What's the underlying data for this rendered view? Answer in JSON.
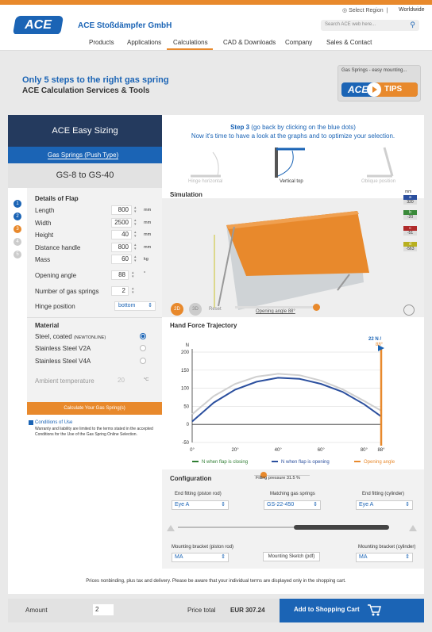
{
  "header": {
    "company": "ACE Stoßdämpfer GmbH",
    "logo_text": "ACE",
    "select_region": "Select Region",
    "separator": "|",
    "worldwide": "Worldwide",
    "search_placeholder": "Search ACE web here..."
  },
  "nav": {
    "items": [
      "Products",
      "Applications",
      "Calculations",
      "CAD & Downloads",
      "Company",
      "Sales & Contact"
    ],
    "active": "Calculations"
  },
  "hero": {
    "line1": "Only 5 steps to the right gas spring",
    "line2": "ACE Calculation Services & Tools",
    "tips_caption": "Gas Springs - easy mounting...",
    "tips_ace": "ACE",
    "tips_label": "TIPS"
  },
  "sizing": {
    "title": "ACE Easy Sizing",
    "subtitle": "Gas Springs (Push Type)",
    "range": "GS-8 to GS-40"
  },
  "step": {
    "title_bold": "Step 3",
    "title_rest": " (go back by clicking on the blue dots)",
    "text": "Now it's time to have a look at the graphs and to optimize your selection.",
    "options": [
      "Hinge horizontal",
      "Vertical top",
      "Oblique position"
    ],
    "selected": "Vertical top"
  },
  "steps_nav": [
    "1",
    "2",
    "3",
    "4",
    "5"
  ],
  "flap": {
    "heading": "Details of Flap",
    "fields": [
      {
        "label": "Length",
        "value": "800",
        "unit": "mm"
      },
      {
        "label": "Width",
        "value": "2500",
        "unit": "mm"
      },
      {
        "label": "Height",
        "value": "40",
        "unit": "mm"
      },
      {
        "label": "Distance handle",
        "value": "800",
        "unit": "mm"
      },
      {
        "label": "Mass",
        "value": "60",
        "unit": "kg"
      },
      {
        "label": "Opening angle",
        "value": "88",
        "unit": "°"
      },
      {
        "label": "Number of gas springs",
        "value": "2",
        "unit": ""
      }
    ],
    "hinge_label": "Hinge position",
    "hinge_value": "bottom",
    "hinge_arrow": "⇕"
  },
  "material": {
    "heading": "Material",
    "options": [
      {
        "label": "Steel, coated",
        "suffix": "(NEWTONLINE)",
        "selected": true
      },
      {
        "label": "Stainless Steel V2A",
        "suffix": "",
        "selected": false
      },
      {
        "label": "Stainless Steel V4A",
        "suffix": "",
        "selected": false
      }
    ],
    "ambient_label": "Ambient temperature",
    "ambient_value": "20",
    "ambient_unit": "°C",
    "calc_button": "Calculate Your Gas Spring(s)"
  },
  "conditions": {
    "title": "Conditions of Use",
    "text": "Warranty and liability are limited to the terms stated in the accepted Conditions for the Use of the Gas Spring Online Selection."
  },
  "simulation": {
    "title": "Simulation",
    "unit": "mm",
    "dims": [
      {
        "label": "a",
        "value": "320",
        "color": "#2b4f9e"
      },
      {
        "label": "b",
        "value": "-20",
        "color": "#3a8a3a"
      },
      {
        "label": "c",
        "value": "-51",
        "color": "#b02a2a"
      },
      {
        "label": "d",
        "value": "-563",
        "color": "#b8b020"
      }
    ],
    "btn_2d": "2D",
    "btn_3d": "3D",
    "reset": "Reset",
    "angle_label": "Opening angle 88°",
    "angle_fraction": 1.0
  },
  "chart_data": {
    "type": "line",
    "title": "Hand Force Trajectory",
    "ylabel": "N",
    "x_ticks": [
      "0°",
      "20°",
      "40°",
      "60°",
      "80°",
      "88°"
    ],
    "y_ticks": [
      "200",
      "150",
      "100",
      "50",
      "0",
      "-50"
    ],
    "xlim": [
      0,
      88
    ],
    "ylim": [
      -50,
      200
    ],
    "x": [
      0,
      10,
      20,
      30,
      40,
      50,
      60,
      70,
      80,
      88
    ],
    "series": [
      {
        "name": "N when flap is closing",
        "color": "#2e7d32",
        "values": [
          28,
          78,
          112,
          132,
          140,
          136,
          121,
          97,
          65,
          38
        ]
      },
      {
        "name": "N when flap is opening",
        "color": "#2b4f9e",
        "values": [
          8,
          60,
          96,
          118,
          129,
          126,
          112,
          90,
          56,
          22
        ]
      }
    ],
    "opening_angle": {
      "name": "Opening angle",
      "color": "#e8892c",
      "value": 88
    },
    "marker_force_label": "22 N /",
    "marker_angle_label": "88°"
  },
  "config": {
    "title": "Configuration",
    "filling_label": "Filling pressure 31.5 %",
    "filling_fraction": 0.315,
    "end_piston_label": "End fitting (piston rod)",
    "end_piston_value": "Eye A",
    "springs_label": "Matching gas springs",
    "springs_value": "GS-22-450",
    "end_cyl_label": "End fitting (cylinder)",
    "end_cyl_value": "Eye A",
    "bracket_piston_label": "Mounting bracket (piston rod)",
    "bracket_piston_value": "MA",
    "sketch_button": "Mounting Sketch (pdf)",
    "bracket_cyl_label": "Mounting bracket (cylinder)",
    "bracket_cyl_value": "MA"
  },
  "notice": "Prices nonbinding, plus tax and delivery. Please be aware that your individual terms are displayed only in the shopping cart.",
  "footer": {
    "amount_label": "Amount",
    "amount_value": "2",
    "price_label": "Price total",
    "price_value": "EUR 307.24",
    "cart_button": "Add to Shopping Cart"
  }
}
